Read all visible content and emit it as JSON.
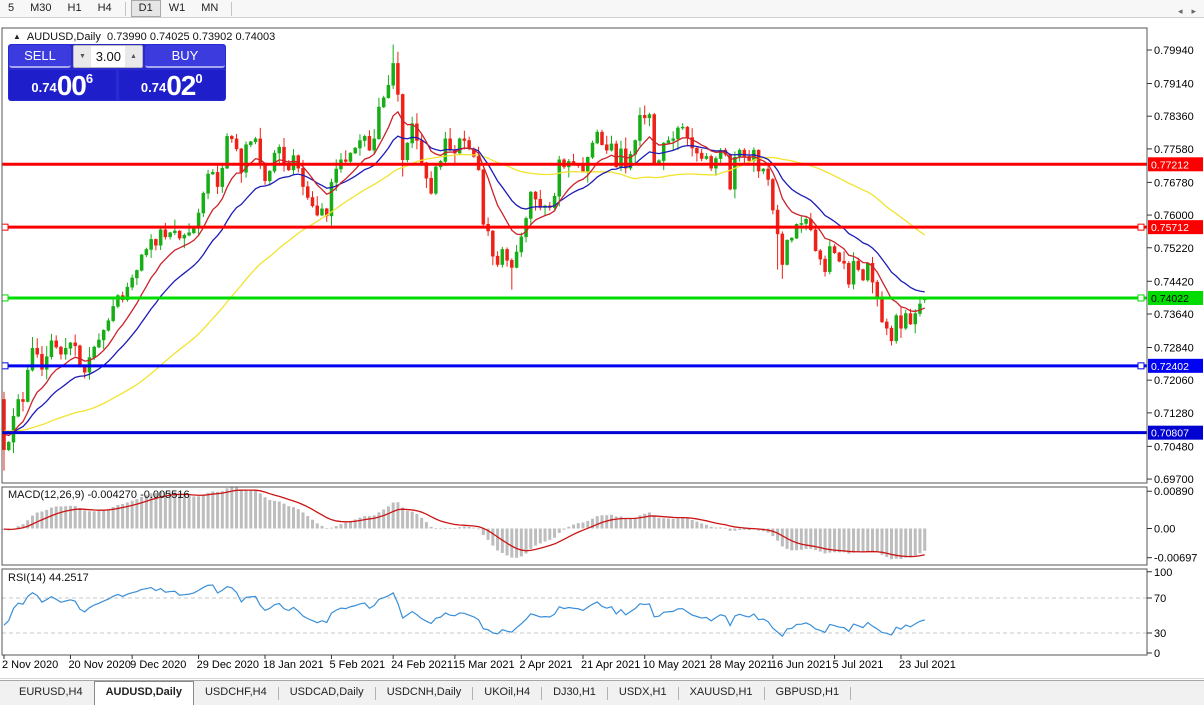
{
  "toolbar": {
    "timeframes": [
      {
        "label": "5",
        "active": false
      },
      {
        "label": "M30",
        "active": false
      },
      {
        "label": "H1",
        "active": false
      },
      {
        "label": "H4",
        "active": false
      },
      {
        "label": "D1",
        "active": true
      },
      {
        "label": "W1",
        "active": false
      },
      {
        "label": "MN",
        "active": false
      }
    ]
  },
  "chart_header": {
    "collapse_icon": "▲",
    "symbol_title": "AUDUSD,Daily",
    "ohlc": "0.73990 0.74025 0.73902 0.74003"
  },
  "trade_panel": {
    "sell_label": "SELL",
    "buy_label": "BUY",
    "volume": "3.00",
    "spinner_down": "▼",
    "spinner_up": "▲",
    "sell_price": {
      "small": "0.74",
      "big": "00",
      "sup": "6"
    },
    "buy_price": {
      "small": "0.74",
      "big": "02",
      "sup": "0"
    }
  },
  "price_axis_ticks": [
    "0.79940",
    "0.79140",
    "0.78360",
    "0.77580",
    "0.76780",
    "0.76000",
    "0.75220",
    "0.74420",
    "0.73640",
    "0.72840",
    "0.72060",
    "0.71280",
    "0.70480",
    "0.69700"
  ],
  "macd_panel": {
    "label": "MACD(12,26,9) -0.004270 -0.005516",
    "axis": [
      "0.00890",
      "0.00",
      "-0.00697"
    ]
  },
  "rsi_panel": {
    "label": "RSI(14) 44.2517",
    "axis": [
      "100",
      "70",
      "30",
      "0"
    ]
  },
  "date_axis": {
    "labels": [
      "2 Nov 2020",
      "20 Nov 2020",
      "9 Dec 2020",
      "29 Dec 2020",
      "18 Jan 2021",
      "5 Feb 2021",
      "24 Feb 2021",
      "15 Mar 2021",
      "2 Apr 2021",
      "21 Apr 2021",
      "10 May 2021",
      "28 May 2021",
      "16 Jun 2021",
      "5 Jul 2021",
      "23 Jul 2021"
    ],
    "tick_indices": [
      0,
      14,
      27,
      41,
      55,
      69,
      82,
      95,
      109,
      122,
      135,
      149,
      162,
      175,
      189
    ]
  },
  "tabs": {
    "items": [
      "EURUSD,H4",
      "AUDUSD,Daily",
      "USDCHF,H4",
      "USDCAD,Daily",
      "USDCNH,Daily",
      "UKOil,H4",
      "DJ30,H1",
      "USDX,H1",
      "XAUUSD,H1",
      "GBPUSD,H1"
    ],
    "active_index": 1,
    "scroll_left": "◂",
    "scroll_right": "▸"
  },
  "chart_data": {
    "type": "candlestick",
    "symbol": "AUDUSD",
    "timeframe": "Daily",
    "title": "AUDUSD,Daily",
    "ohlc_display": {
      "open": 0.7399,
      "high": 0.74025,
      "low": 0.73902,
      "close": 0.74003
    },
    "sell_quote": 0.74006,
    "buy_quote": 0.7402,
    "y_axis_range": [
      0.697,
      0.7994
    ],
    "closes": [
      0.704,
      0.7058,
      0.712,
      0.716,
      0.7155,
      0.723,
      0.7282,
      0.7268,
      0.7232,
      0.7262,
      0.73,
      0.7285,
      0.7268,
      0.7282,
      0.7295,
      0.7288,
      0.7242,
      0.7225,
      0.726,
      0.7285,
      0.7302,
      0.7325,
      0.7348,
      0.7382,
      0.7408,
      0.7398,
      0.7428,
      0.745,
      0.7468,
      0.7505,
      0.7518,
      0.7542,
      0.7528,
      0.7565,
      0.7548,
      0.7558,
      0.7562,
      0.7545,
      0.7552,
      0.7558,
      0.7572,
      0.7605,
      0.7652,
      0.7698,
      0.7702,
      0.7668,
      0.7712,
      0.7788,
      0.7782,
      0.7758,
      0.7702,
      0.7768,
      0.7775,
      0.7782,
      0.7722,
      0.7682,
      0.7705,
      0.7748,
      0.7762,
      0.7722,
      0.7708,
      0.7742,
      0.7712,
      0.7668,
      0.7642,
      0.7622,
      0.76,
      0.7615,
      0.7598,
      0.7678,
      0.771,
      0.7732,
      0.7728,
      0.7748,
      0.776,
      0.7778,
      0.7788,
      0.7755,
      0.7782,
      0.7858,
      0.788,
      0.791,
      0.7962,
      0.7888,
      0.7732,
      0.7772,
      0.7818,
      0.7778,
      0.7725,
      0.7688,
      0.7652,
      0.7715,
      0.7728,
      0.7782,
      0.7755,
      0.7748,
      0.7782,
      0.7778,
      0.7758,
      0.774,
      0.7708,
      0.7578,
      0.7562,
      0.7502,
      0.7482,
      0.7518,
      0.7492,
      0.7475,
      0.7512,
      0.7548,
      0.7592,
      0.7655,
      0.7638,
      0.7618,
      0.7622,
      0.7618,
      0.7645,
      0.7732,
      0.7715,
      0.7728,
      0.7722,
      0.7718,
      0.7705,
      0.7738,
      0.7772,
      0.7798,
      0.7768,
      0.7755,
      0.777,
      0.7715,
      0.7758,
      0.7712,
      0.7745,
      0.7778,
      0.7838,
      0.7832,
      0.784,
      0.7725,
      0.773,
      0.7772,
      0.7778,
      0.7782,
      0.7808,
      0.781,
      0.7785,
      0.776,
      0.7748,
      0.7735,
      0.774,
      0.7712,
      0.7735,
      0.7755,
      0.7745,
      0.7662,
      0.7738,
      0.7755,
      0.774,
      0.773,
      0.7755,
      0.7705,
      0.771,
      0.7685,
      0.7612,
      0.7555,
      0.7482,
      0.754,
      0.7545,
      0.7578,
      0.758,
      0.759,
      0.7565,
      0.7515,
      0.7495,
      0.7465,
      0.7525,
      0.751,
      0.749,
      0.7485,
      0.7435,
      0.749,
      0.747,
      0.7445,
      0.7485,
      0.744,
      0.74,
      0.7345,
      0.733,
      0.73,
      0.736,
      0.733,
      0.7365,
      0.734,
      0.7365,
      0.7388,
      0.74003
    ],
    "overrides": {
      "0": {
        "open": 0.716,
        "high": 0.7178,
        "low": 0.699
      },
      "82": {
        "high": 0.8007
      },
      "84": {
        "low": 0.7692
      },
      "107": {
        "low": 0.7422
      },
      "163": {
        "low": 0.747
      },
      "164": {
        "low": 0.7448
      },
      "187": {
        "low": 0.7289
      },
      "194": {
        "open": 0.7399,
        "high": 0.74025,
        "low": 0.73902,
        "close": 0.74003
      }
    },
    "colors": {
      "up": "#16ad16",
      "down": "#ee2116",
      "ma_fast": "#cc2229",
      "ma_mid": "#1c1cb8",
      "ma_slow": "#f2e32c",
      "macd_hist": "#bdbdbd",
      "macd_signal": "#cc1414",
      "rsi_line": "#3a8fd8",
      "hline_red": "#fc0000",
      "hline_green": "#00dc00",
      "hline_blue": "#0202f2",
      "hline_blue_dark": "#0101d2"
    },
    "moving_averages": [
      {
        "name": "fast",
        "type": "ema",
        "period": 10,
        "color_key": "ma_fast"
      },
      {
        "name": "mid",
        "type": "ema",
        "period": 21,
        "color_key": "ma_mid"
      },
      {
        "name": "slow",
        "type": "sma",
        "period": 50,
        "color_key": "ma_slow"
      }
    ],
    "hlines": [
      {
        "price": 0.77212,
        "label": "0.77212",
        "color_key": "hline_red",
        "text_color": "#ffffff",
        "handles": false
      },
      {
        "price": 0.75712,
        "label": "0.75712",
        "color_key": "hline_red",
        "text_color": "#ffffff",
        "handles": true
      },
      {
        "price": 0.74022,
        "label": "0.74022",
        "color_key": "hline_green",
        "text_color": "#000000",
        "handles": true
      },
      {
        "price": 0.72402,
        "label": "0.72402",
        "color_key": "hline_blue",
        "text_color": "#ffffff",
        "handles": true
      },
      {
        "price": 0.70807,
        "label": "0.70807",
        "color_key": "hline_blue_dark",
        "text_color": "#ffffff",
        "handles": false
      }
    ],
    "indicators": {
      "macd": {
        "fast": 12,
        "slow": 26,
        "signal": 9,
        "main_value": -0.00427,
        "signal_value": -0.005516,
        "axis_max": 0.0089,
        "axis_min": -0.00697
      },
      "rsi": {
        "period": 14,
        "value": 44.2517,
        "levels": [
          70,
          30
        ],
        "axis": [
          100,
          70,
          30,
          0
        ]
      }
    }
  }
}
